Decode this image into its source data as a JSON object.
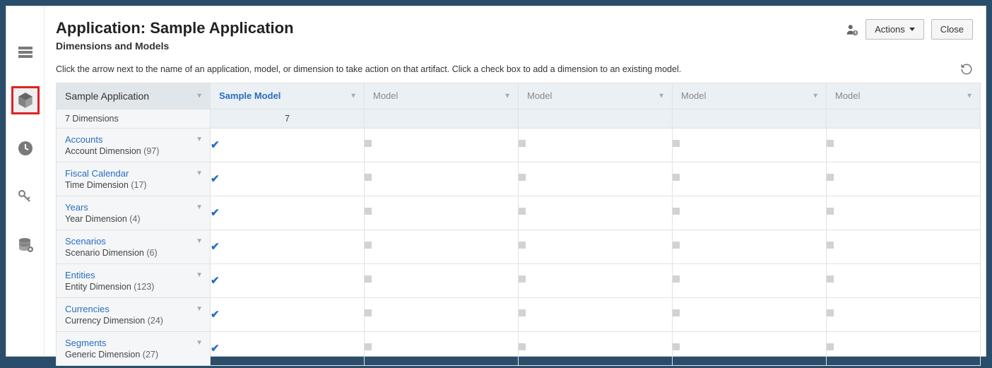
{
  "header": {
    "title": "Application: Sample Application",
    "subtitle": "Dimensions and Models",
    "actions_label": "Actions",
    "close_label": "Close"
  },
  "instructions": "Click the arrow next to the name of an application, model, or dimension to take action on that artifact. Click a check box to add a dimension to an existing model.",
  "columns": {
    "app": "Sample Application",
    "model1": "Sample Model",
    "model2": "Model",
    "model3": "Model",
    "model4": "Model",
    "model5": "Model"
  },
  "summary": {
    "dimensions_label": "7  Dimensions",
    "model1_count": "7",
    "model2_count": "",
    "model3_count": "",
    "model4_count": "",
    "model5_count": ""
  },
  "rows": [
    {
      "name": "Accounts",
      "desc": "Account Dimension",
      "count": "(97)"
    },
    {
      "name": "Fiscal Calendar",
      "desc": "Time Dimension",
      "count": "(17)"
    },
    {
      "name": "Years",
      "desc": "Year Dimension",
      "count": "(4)"
    },
    {
      "name": "Scenarios",
      "desc": "Scenario Dimension",
      "count": "(6)"
    },
    {
      "name": "Entities",
      "desc": "Entity Dimension",
      "count": "(123)"
    },
    {
      "name": "Currencies",
      "desc": "Currency Dimension",
      "count": "(24)"
    },
    {
      "name": "Segments",
      "desc": "Generic Dimension",
      "count": "(27)"
    }
  ]
}
